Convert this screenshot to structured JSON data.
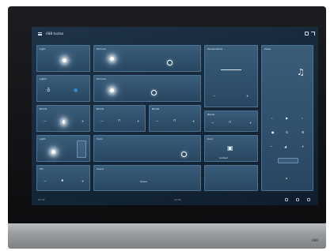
{
  "device": {
    "base_logo": "ABB"
  },
  "topbar": {
    "title": "ABB-tacteo"
  },
  "tiles": {
    "light_1": {
      "label": "Light"
    },
    "dimmer_1": {
      "label": "Dimmer"
    },
    "scene_1": {
      "label": "Temperature"
    },
    "music": {
      "label": "Music",
      "zone_label": "Zone 1"
    },
    "light_2": {
      "label": "Lights"
    },
    "dimmer_2": {
      "label": "Dimmer"
    },
    "blind_1": {
      "label": "Blinds"
    },
    "blind_2": {
      "label": "Blinds"
    },
    "blind_3": {
      "label": "Blinds"
    },
    "blind_4": {
      "label": "Blinds"
    },
    "light_3": {
      "label": "Light"
    },
    "rgb": {
      "label": "Color"
    },
    "lock": {
      "label": "Door",
      "status": "Locked"
    },
    "fan": {
      "label": "Fan"
    },
    "scene_2": {
      "label": "Scene",
      "button_label": "Scene"
    }
  },
  "bottombar": {
    "left_text": "22:32",
    "center_text": "12:00"
  }
}
